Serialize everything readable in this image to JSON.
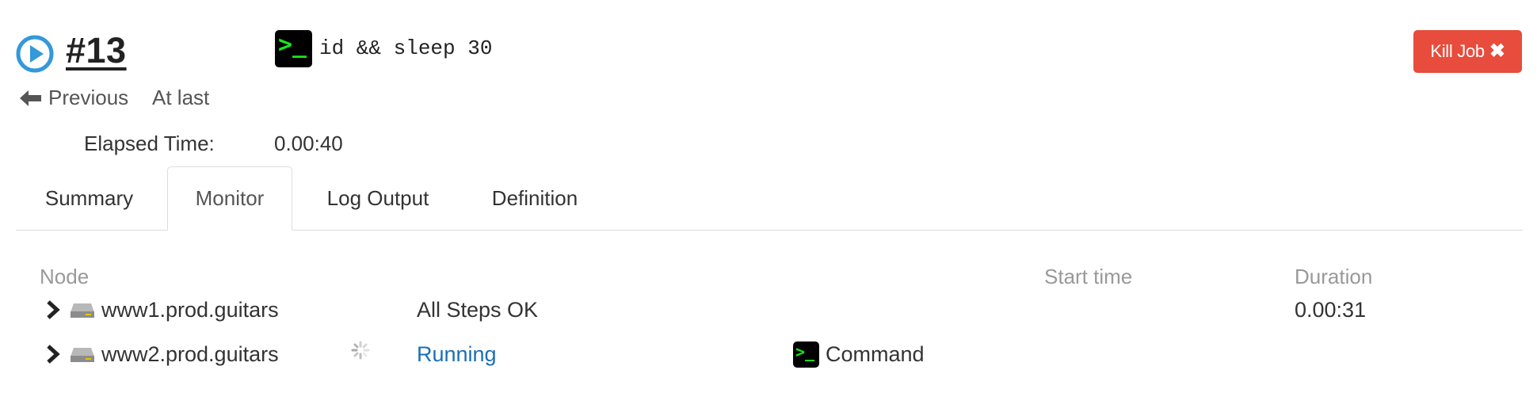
{
  "job": {
    "id_label": "#13",
    "command": "id && sleep 30",
    "kill_button_label": "Kill Job",
    "previous_label": "Previous",
    "at_last_label": "At last",
    "elapsed_label": "Elapsed Time:",
    "elapsed_value": "0.00:40"
  },
  "tabs": [
    {
      "label": "Summary",
      "active": false
    },
    {
      "label": "Monitor",
      "active": true
    },
    {
      "label": "Log Output",
      "active": false
    },
    {
      "label": "Definition",
      "active": false
    }
  ],
  "table": {
    "headers": {
      "node": "Node",
      "start_time": "Start time",
      "duration": "Duration"
    },
    "rows": [
      {
        "node": "www1.prod.guitars",
        "status": "All Steps OK",
        "step": "",
        "start_time": "",
        "duration": "0.00:31"
      },
      {
        "node": "www2.prod.guitars",
        "status": "Running",
        "step": "Command",
        "start_time": "",
        "duration": ""
      }
    ]
  },
  "icons": {
    "running": "play-circle-icon",
    "command": "terminal-icon",
    "kill": "close-icon",
    "previous": "arrow-left-icon",
    "expand": "chevron-right-icon",
    "node": "server-icon",
    "spinner": "loading-spinner-icon"
  },
  "colors": {
    "running_blue": "#3498db",
    "kill_red": "#e74c3c",
    "link_blue": "#1a6fb5",
    "terminal_green": "#19e619",
    "header_gray": "#999999"
  }
}
